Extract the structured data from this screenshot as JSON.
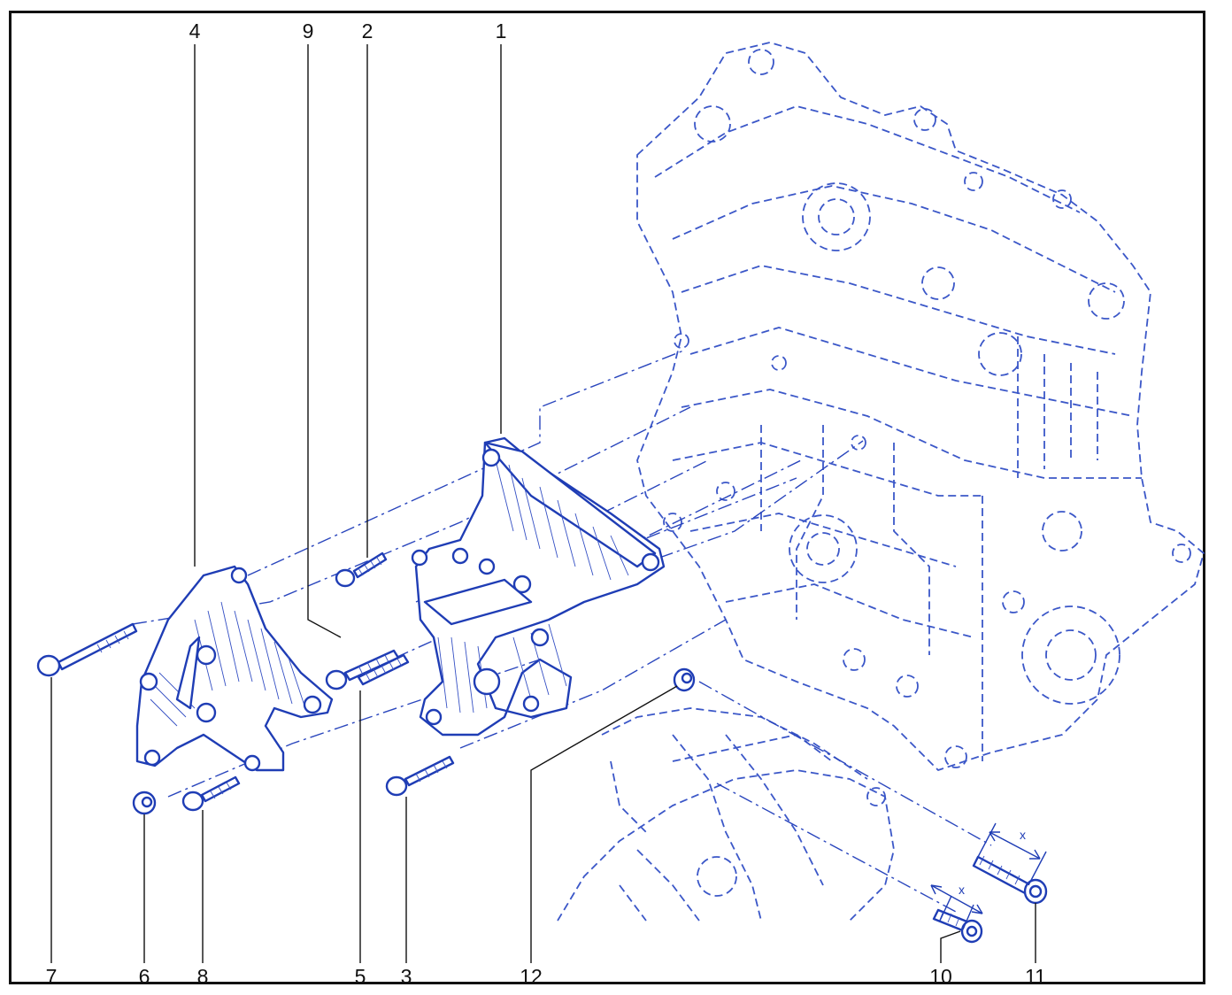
{
  "callouts": {
    "c1": "1",
    "c2": "2",
    "c3": "3",
    "c4": "4",
    "c5": "5",
    "c6": "6",
    "c7": "7",
    "c8": "8",
    "c9": "9",
    "c10": "10",
    "c11": "11",
    "c12": "12"
  },
  "dimensions": {
    "x_upper": "x",
    "x_lower": "x"
  },
  "colors": {
    "line": "#1f3db5",
    "ghost": "#3b57c8",
    "frame": "#111111",
    "background": "#ffffff"
  }
}
